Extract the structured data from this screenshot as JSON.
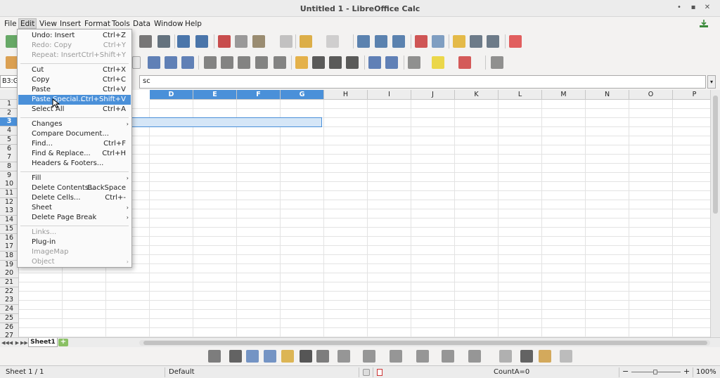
{
  "window": {
    "title": "Untitled 1 - LibreOffice Calc",
    "min_glyph": "•",
    "max_glyph": "▪",
    "close_glyph": "✕",
    "download_icon": "download-icon"
  },
  "menubar": [
    "File",
    "Edit",
    "View",
    "Insert",
    "Format",
    "Tools",
    "Data",
    "Window",
    "Help"
  ],
  "active_menu": "Edit",
  "formula": {
    "namebox": "B3:G",
    "content": "sc",
    "dropdown_glyph": "▾"
  },
  "columns": [
    "D",
    "E",
    "F",
    "G",
    "H",
    "I",
    "J",
    "K",
    "L",
    "M",
    "N",
    "O",
    "P"
  ],
  "rows": [
    "1",
    "2",
    "3",
    "4",
    "5",
    "6",
    "7",
    "8",
    "9",
    "10",
    "11",
    "12",
    "13",
    "14",
    "15",
    "16",
    "17",
    "18",
    "19",
    "20",
    "21",
    "22",
    "23",
    "24",
    "25",
    "26",
    "27"
  ],
  "selected_row": "3",
  "sheet_tabs": {
    "name": "Sheet1",
    "add": "+",
    "nav": [
      "◀◀",
      "◀",
      "▶",
      "▶▶"
    ]
  },
  "edit_menu": [
    {
      "label": "Undo: Insert",
      "shortcut": "Ctrl+Z",
      "disabled": false
    },
    {
      "label": "Redo: Copy",
      "shortcut": "Ctrl+Y",
      "disabled": true
    },
    {
      "label": "Repeat: Insert",
      "shortcut": "Ctrl+Shift+Y",
      "disabled": true
    },
    {
      "separator": true
    },
    {
      "label": "Cut",
      "shortcut": "Ctrl+X",
      "disabled": false
    },
    {
      "label": "Copy",
      "shortcut": "Ctrl+C",
      "disabled": false
    },
    {
      "label": "Paste",
      "shortcut": "Ctrl+V",
      "disabled": false
    },
    {
      "label": "Paste Special...",
      "shortcut": "Ctrl+Shift+V",
      "disabled": false,
      "highlighted": true
    },
    {
      "label": "Select All",
      "shortcut": "Ctrl+A",
      "disabled": false
    },
    {
      "separator": true
    },
    {
      "label": "Changes",
      "submenu": true,
      "disabled": false
    },
    {
      "label": "Compare Document...",
      "disabled": false
    },
    {
      "label": "Find...",
      "shortcut": "Ctrl+F",
      "disabled": false
    },
    {
      "label": "Find & Replace...",
      "shortcut": "Ctrl+H",
      "disabled": false
    },
    {
      "label": "Headers & Footers...",
      "disabled": false
    },
    {
      "separator": true
    },
    {
      "label": "Fill",
      "submenu": true,
      "disabled": false
    },
    {
      "label": "Delete Contents...",
      "shortcut": "BackSpace",
      "disabled": false
    },
    {
      "label": "Delete Cells...",
      "shortcut": "Ctrl+-",
      "disabled": false
    },
    {
      "label": "Sheet",
      "submenu": true,
      "disabled": false
    },
    {
      "label": "Delete Page Break",
      "submenu": true,
      "disabled": false
    },
    {
      "separator": true
    },
    {
      "label": "Links...",
      "disabled": true
    },
    {
      "label": "Plug-in",
      "disabled": false
    },
    {
      "label": "ImageMap",
      "disabled": true
    },
    {
      "label": "Object",
      "submenu": true,
      "disabled": true
    }
  ],
  "status": {
    "sheet": "Sheet 1 / 1",
    "style": "Default",
    "count": "CountA=0",
    "zoom": "100%",
    "zoom_minus": "−",
    "zoom_plus": "+"
  },
  "colors": {
    "accent": "#4a90d9",
    "selection_fill": "#d5e6f7"
  }
}
